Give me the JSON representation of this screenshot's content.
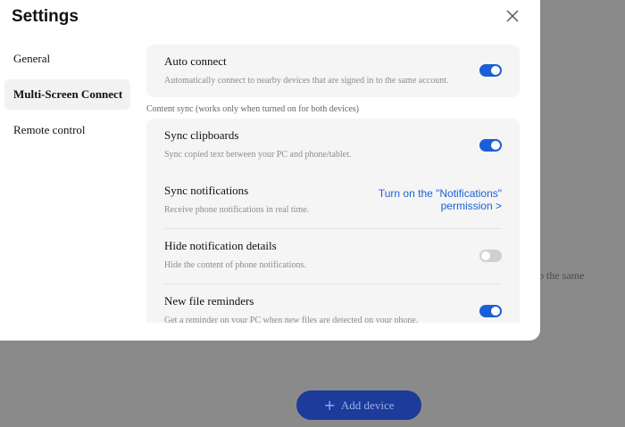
{
  "dialog": {
    "title": "Settings"
  },
  "nav": [
    {
      "label": "General",
      "active": false
    },
    {
      "label": "Multi-Screen Connect",
      "active": true
    },
    {
      "label": "Remote control",
      "active": false
    }
  ],
  "auto_connect": {
    "title": "Auto connect",
    "desc": "Automatically connect to nearby devices that are signed in to the same account.",
    "enabled": true
  },
  "content_sync_label": "Content sync (works only when turned on for both devices)",
  "sync_items": [
    {
      "title": "Sync clipboards",
      "desc": "Sync copied text between your PC and phone/tablet.",
      "enabled": true
    },
    {
      "title": "Sync notifications",
      "desc": "Receive phone notifications in real time.",
      "action_line1": "Turn on the \"Notifications\"",
      "action_line2": "permission >"
    },
    {
      "title": "Hide notification details",
      "desc": "Hide the content of phone notifications.",
      "enabled": false
    },
    {
      "title": "New file reminders",
      "desc": "Get a reminder on your PC when new files are detected on your phone.",
      "enabled": true
    }
  ],
  "background": {
    "partial_text": "o the same",
    "add_device_label": "Add device"
  },
  "colors": {
    "accent": "#1a5fd6",
    "toggle_off": "#d0d0d0",
    "card_bg": "#f5f5f5",
    "overlay": "#8a8a8a"
  }
}
